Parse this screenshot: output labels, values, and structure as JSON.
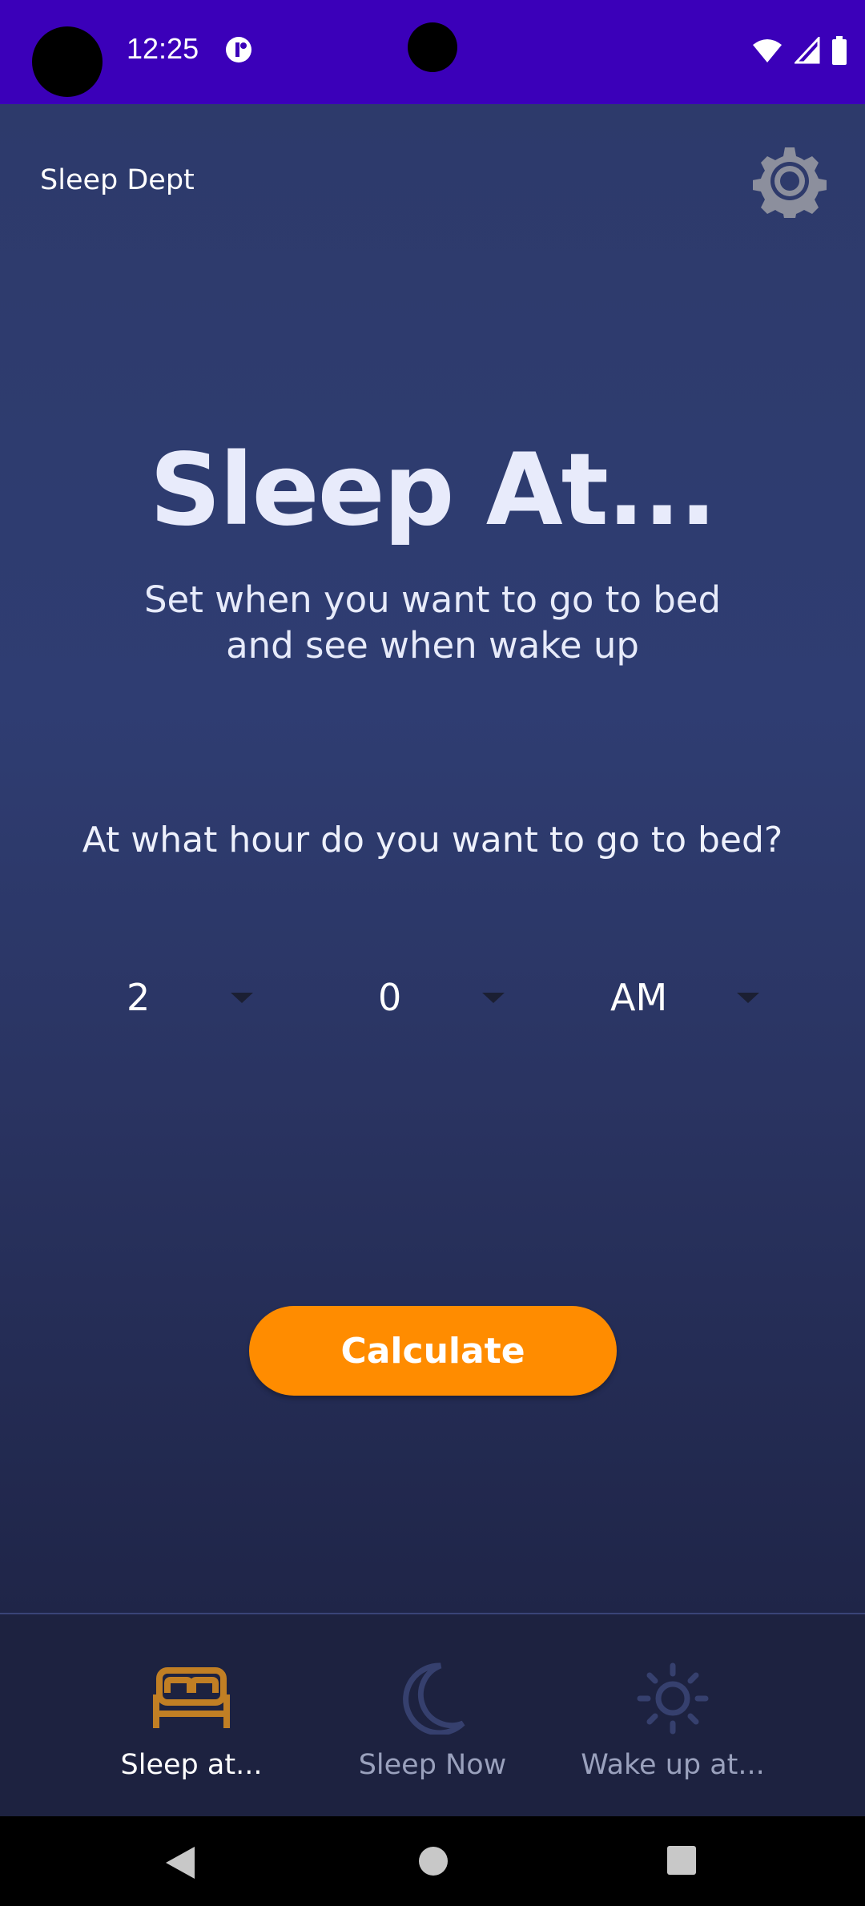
{
  "status_bar": {
    "time": "12:25",
    "bg_color": "#3b00b9"
  },
  "header": {
    "app_name": "Sleep Dept",
    "settings_icon": "gear-icon"
  },
  "main": {
    "title": "Sleep At...",
    "subtitle_line1": "Set when you want to go to bed",
    "subtitle_line2": "and see when wake up",
    "question": "At what hour do you want to go to bed?",
    "hour": "2",
    "minute": "0",
    "period": "AM",
    "calculate_label": "Calculate",
    "accent": "#ff8c00"
  },
  "bottom_nav": {
    "items": [
      {
        "label": "Sleep at...",
        "icon": "bed-icon",
        "active": true
      },
      {
        "label": "Sleep Now",
        "icon": "moon-icon",
        "active": false
      },
      {
        "label": "Wake up at...",
        "icon": "sun-icon",
        "active": false
      }
    ],
    "active_color": "#c17f24",
    "inactive_color": "#36406e"
  }
}
